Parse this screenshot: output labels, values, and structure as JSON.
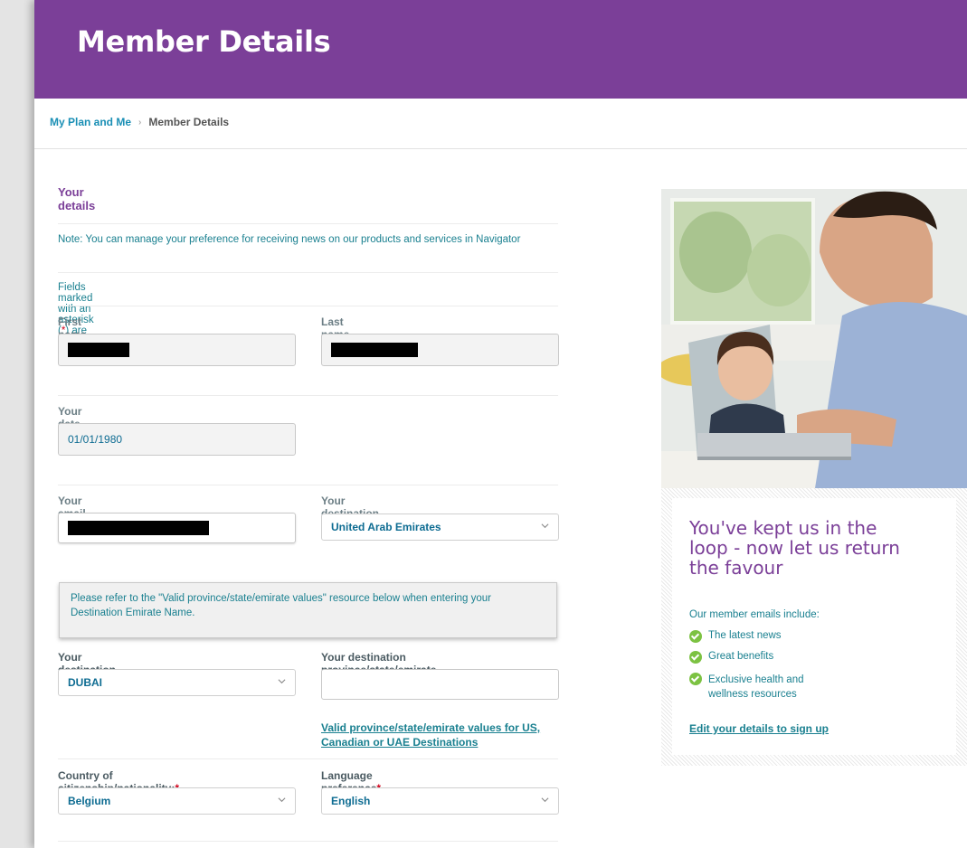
{
  "header": {
    "title": "Member Details"
  },
  "breadcrumb": {
    "parent": "My Plan and Me",
    "separator": "›",
    "current": "Member Details"
  },
  "form": {
    "section_title": "Your details",
    "note": "Note: You can manage your preference for receiving news on our products and services in Navigator",
    "required_note_prefix": "Fields marked with an asterisk (",
    "required_note_star": "*",
    "required_note_suffix": ") are required.",
    "first_name": {
      "label": "First name"
    },
    "last_name": {
      "label": "Last name"
    },
    "dob": {
      "label": "Your date of birth",
      "value": "01/01/1980"
    },
    "email": {
      "label": "Your email address",
      "star": "*"
    },
    "destination_country": {
      "label": "Your destination country",
      "value": "United Arab Emirates"
    },
    "info_box": "Please refer to the \"Valid province/state/emirate values\" resource below when entering your Destination Emirate Name.",
    "destination_city": {
      "label": "Your destination city",
      "star": "*",
      "value": "DUBAI"
    },
    "destination_province": {
      "label": "Your destination province/state/emirate",
      "value": ""
    },
    "province_link": "Valid province/state/emirate values for US, Canadian or UAE Destinations",
    "citizenship": {
      "label": "Country of citizenship/nationality:",
      "star": "*",
      "value": "Belgium"
    },
    "language": {
      "label": "Language preference",
      "star": "*",
      "value": "English"
    }
  },
  "promo": {
    "title": "You've kept us in the loop - now let us return the favour",
    "subtitle": "Our member emails include:",
    "benefits": [
      "The latest news",
      "Great benefits",
      "Exclusive health and wellness resources"
    ],
    "link": "Edit your details to sign up",
    "check_color": "#7cc242"
  },
  "colors": {
    "brand": "#7b3f98",
    "teal": "#1a8090",
    "link": "#1a8fb5",
    "required": "#d0021b"
  }
}
